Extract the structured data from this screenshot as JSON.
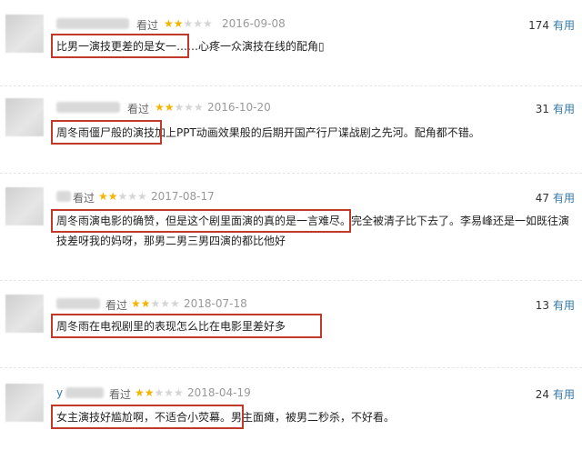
{
  "reviews": [
    {
      "user": "",
      "watched": "看过",
      "rating": 2,
      "date": "2016-09-08",
      "votes": "174",
      "useful": "有用",
      "text": "比男一演技更差的是女一……心疼一众演技在线的配角▯",
      "highlight": "比男一演技更差的是女一"
    },
    {
      "user": "",
      "watched": "看过",
      "rating": 2,
      "date": "2016-10-20",
      "votes": "31",
      "useful": "有用",
      "text": "周冬雨僵尸般的演技加上PPT动画效果般的后期开国产行尸谍战剧之先河。配角都不错。",
      "highlight": "周冬雨僵尸般的演技"
    },
    {
      "user": "",
      "watched": "看过",
      "rating": 2,
      "date": "2017-08-17",
      "votes": "47",
      "useful": "有用",
      "text": "周冬雨演电影的确赞，但是这个剧里面演的真的是一言难尽。完全被清子比下去了。李易峰还是一如既往演技差呀我的妈呀，那男二男三男四演的都比他好",
      "highlight": "周冬雨演电影的确赞，但是这个剧里面演的真的是一言难尽。"
    },
    {
      "user": "",
      "watched": "看过",
      "rating": 2,
      "date": "2018-07-18",
      "votes": "13",
      "useful": "有用",
      "text": "周冬雨在电视剧里的表现怎么比在电影里差好多",
      "highlight": "周冬雨在电视剧里的表现怎么比在电影里差好多"
    },
    {
      "user": "y",
      "watched": "看过",
      "rating": 2,
      "date": "2018-04-19",
      "votes": "24",
      "useful": "有用",
      "text": "女主演技好尴尬啊，不适合小荧幕。男主面瘫，被男二秒杀，不好看。",
      "highlight": "女主演技好尴尬啊，不适合小荧幕。"
    }
  ],
  "star_full": "★",
  "star_empty": "★"
}
